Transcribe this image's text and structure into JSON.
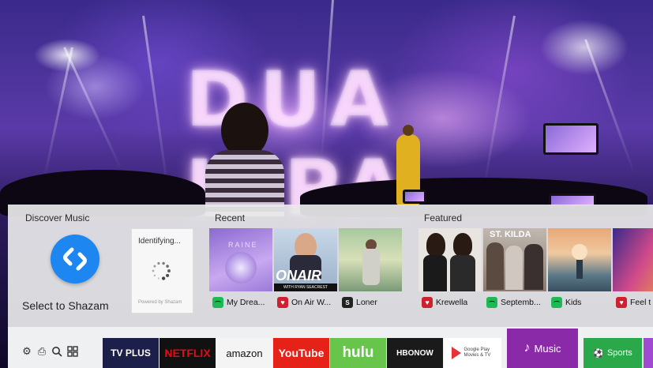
{
  "hero": {
    "stage_text": "DUA LIPA"
  },
  "panel": {
    "discover": {
      "label": "Discover Music",
      "shazam_label": "Select to Shazam",
      "identifying": "Identifying...",
      "powered_by": "Powered by Shazam"
    },
    "recent": {
      "label": "Recent",
      "items": [
        {
          "title": "My Drea...",
          "source": "spotify",
          "art_text": "RAINE"
        },
        {
          "title": "On Air W...",
          "source": "iheart",
          "art_text": "ONAIR",
          "art_sub": "WITH RYAN SEACREST"
        },
        {
          "title": "Loner",
          "source": "shazam"
        }
      ]
    },
    "featured": {
      "label": "Featured",
      "items": [
        {
          "title": "Krewella",
          "source": "iheart"
        },
        {
          "title": "Septemb...",
          "source": "spotify",
          "art_text": "ST. KILDA"
        },
        {
          "title": "Kids",
          "source": "spotify"
        },
        {
          "title": "Feel t",
          "source": "iheart"
        }
      ]
    }
  },
  "bar": {
    "system_icons": [
      "settings-icon",
      "source-icon",
      "search-icon",
      "apps-icon"
    ],
    "apps": [
      {
        "name": "TV PLUS",
        "bg": "#1b1f4a"
      },
      {
        "name": "NETFLIX",
        "bg": "#111111",
        "fg": "#e50914"
      },
      {
        "name": "amazon",
        "bg": "#f4f4f4",
        "fg": "#111111"
      },
      {
        "name": "YouTube",
        "bg": "#e62117"
      },
      {
        "name": "hulu",
        "bg": "#66c54a"
      },
      {
        "name": "HBONOW",
        "bg": "#1a1a1a"
      },
      {
        "name": "Google Play Movies & TV",
        "bg": "#ffffff",
        "fg": "#444444"
      },
      {
        "name": "Music",
        "bg": "#8a2aa8"
      },
      {
        "name": "Sports",
        "bg": "#2aa84a"
      }
    ]
  },
  "colors": {
    "accent": "#8a2aa8",
    "shazam_blue": "#1e86f0",
    "panel_bg": "#e8e8ea"
  }
}
